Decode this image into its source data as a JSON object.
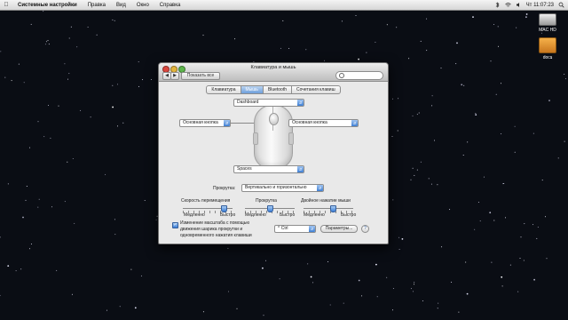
{
  "menubar": {
    "app_name": "Системные настройки",
    "items": [
      "Правка",
      "Вид",
      "Окно",
      "Справка"
    ],
    "clock": "Чт 11:07:23"
  },
  "desktop": {
    "icons": [
      {
        "label": "MAC HD"
      },
      {
        "label": "docs"
      }
    ]
  },
  "window": {
    "title": "Клавиатура и мышь",
    "show_all": "Показать все",
    "search_placeholder": "",
    "tabs": [
      {
        "label": "Клавиатура",
        "selected": false
      },
      {
        "label": "Мышь",
        "selected": true
      },
      {
        "label": "Bluetooth",
        "selected": false
      },
      {
        "label": "Сочетания клавиш",
        "selected": false
      }
    ],
    "mouse_buttons": {
      "scroll_ball": "Dashboard",
      "left": "Основная кнопка",
      "right": "Основная кнопка",
      "side": "Spaces"
    },
    "scrolling_label": "Прокрутка:",
    "scrolling_value": "Вертикально и горизонтально",
    "sliders": [
      {
        "label": "Скорость перемещения",
        "min_label": "Медленно",
        "max_label": "Быстро",
        "value": 0.85
      },
      {
        "label": "Прокрутка",
        "min_label": "Медленно",
        "max_label": "Быстро",
        "value": 0.5
      },
      {
        "label": "Двойное нажатие мыши",
        "min_label": "Медленно",
        "max_label": "Быстро",
        "value": 0.6
      }
    ],
    "zoom_checkbox": {
      "checked": true,
      "line1": "Изменение масштаба с помощью",
      "line2": "движения шарика прокрутки и",
      "line3": "одновременного нажатия клавиши"
    },
    "zoom_modifier": "^ Ctrl",
    "options_button": "Параметры...",
    "help_button": "?"
  }
}
